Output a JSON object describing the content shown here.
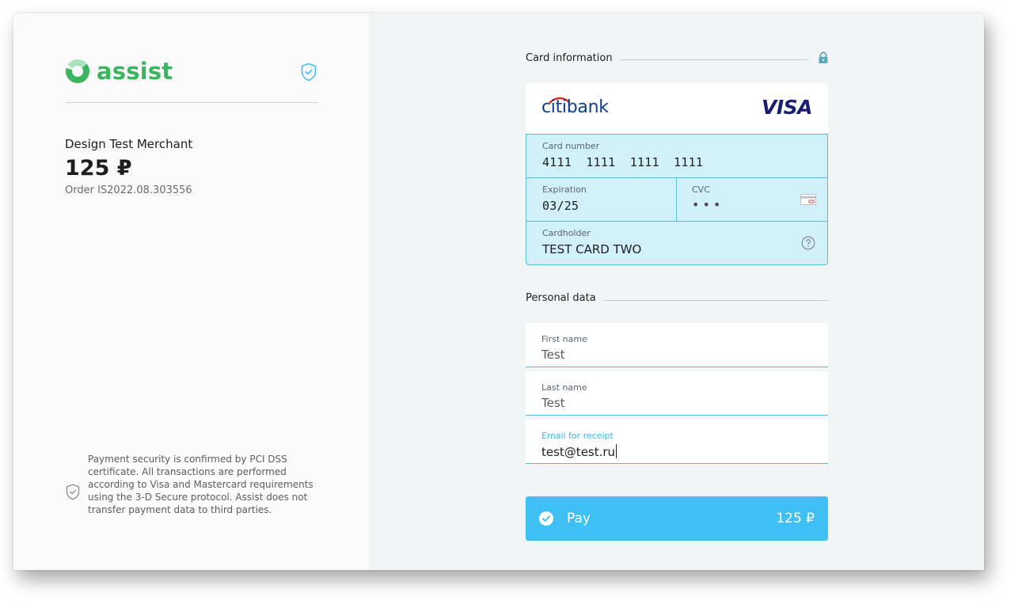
{
  "merchant_panel": {
    "logo_text": "assist",
    "merchant_name": "Design Test Merchant",
    "amount": "125 ₽",
    "order": "Order IS2022.08.303556",
    "security_note": "Payment security is confirmed by PCI DSS certificate. All transactions are performed according to Visa and Mastercard requirements using the 3-D Secure protocol. Assist does not transfer payment data to third parties."
  },
  "card_section": {
    "title": "Card information",
    "bank_name": "citibank",
    "brand": "VISA",
    "card_number_label": "Card number",
    "card_number": "4111  1111  1111  1111",
    "expiration_label": "Expiration",
    "expiration": "03/25",
    "cvc_label": "CVC",
    "cvc": "•••",
    "cardholder_label": "Cardholder",
    "cardholder": "TEST CARD TWO"
  },
  "personal_section": {
    "title": "Personal data",
    "first_name_label": "First name",
    "first_name": "Test",
    "last_name_label": "Last name",
    "last_name": "Test",
    "email_label": "Email for receipt",
    "email": "test@test.ru"
  },
  "pay_button": {
    "label": "Pay",
    "amount": "125 ₽"
  },
  "colors": {
    "brand_green": "#3bb55e",
    "accent_blue": "#3ec0f5",
    "field_bg": "#d1f0f9",
    "field_border": "#55bfe0"
  },
  "icons": [
    "shield-check-icon",
    "lock-icon",
    "card-back-icon",
    "help-icon",
    "check-circle-icon",
    "shield-outline-icon"
  ]
}
